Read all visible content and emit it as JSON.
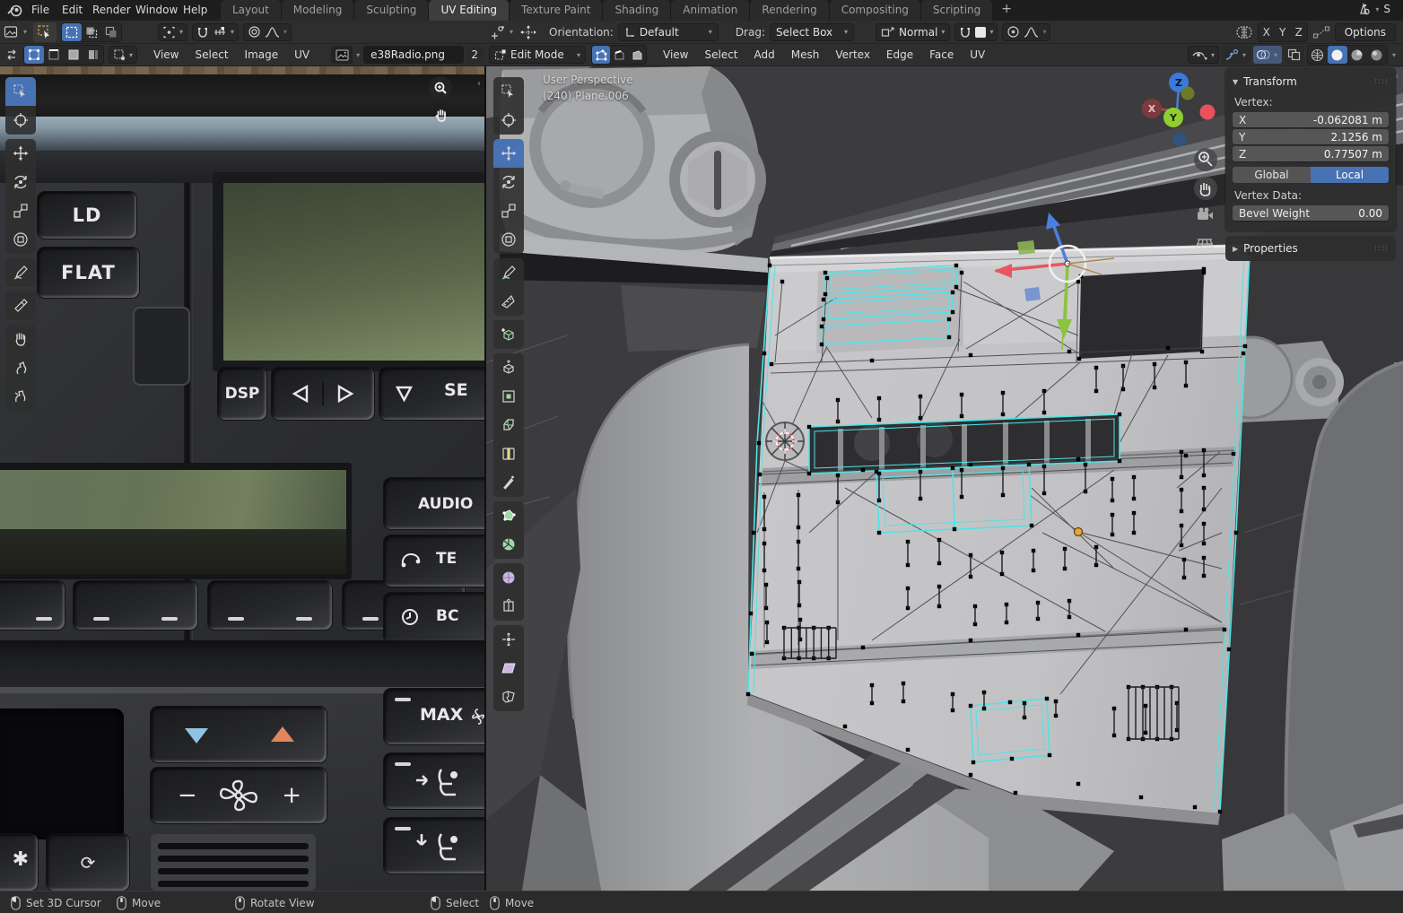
{
  "topbar": {
    "menus": [
      "File",
      "Edit",
      "Render",
      "Window",
      "Help"
    ],
    "tabs": [
      "Layout",
      "Modeling",
      "Sculpting",
      "UV Editing",
      "Texture Paint",
      "Shading",
      "Animation",
      "Rendering",
      "Compositing",
      "Scripting"
    ],
    "active_tab": "UV Editing",
    "new_tab_label": "+",
    "scene_label": "S"
  },
  "uv_editor": {
    "header": {
      "menus": [
        "View",
        "Select",
        "Image",
        "UV"
      ],
      "image_name": "e38Radio.png",
      "image_users": "2"
    },
    "tools": [
      "tweak",
      "cursor",
      "move",
      "rotate",
      "scale",
      "transform",
      "annotate",
      "sample",
      "grab",
      "relax",
      "pinch"
    ],
    "active_tool": "tweak"
  },
  "viewport": {
    "tool_settings": {
      "orientation_label": "Orientation:",
      "orientation_value": "Default",
      "drag_label": "Drag:",
      "drag_value": "Select Box",
      "snap_with_label": "Normal",
      "mirror_axes": [
        "X",
        "Y",
        "Z"
      ],
      "options_label": "Options"
    },
    "header": {
      "mode": "Edit Mode",
      "menus": [
        "View",
        "Select",
        "Add",
        "Mesh",
        "Vertex",
        "Edge",
        "Face",
        "UV"
      ]
    },
    "overlay": {
      "view_label": "User Perspective",
      "object_label": "(240) Plane.006"
    },
    "nav_axes": {
      "x": "X",
      "y": "Y",
      "z": "Z"
    },
    "tools": [
      "tweak",
      "cursor",
      "move",
      "rotate",
      "scale",
      "transform",
      "annotate",
      "measure",
      "add-cube",
      "extrude",
      "inset",
      "bevel",
      "loop-cut",
      "knife",
      "poly-build",
      "spin",
      "smooth",
      "edge-slide",
      "shrink-fatten",
      "shear",
      "rip-region"
    ],
    "active_tool": "move"
  },
  "sidebar": {
    "transform": {
      "title": "Transform",
      "vertex_label": "Vertex:",
      "fields": [
        {
          "label": "X",
          "value": "-0.062081 m"
        },
        {
          "label": "Y",
          "value": "2.1256 m"
        },
        {
          "label": "Z",
          "value": "0.77507 m"
        }
      ],
      "space": [
        {
          "label": "Global",
          "active": false
        },
        {
          "label": "Local",
          "active": true
        }
      ],
      "vertex_data_label": "Vertex Data:",
      "bevel_label": "Bevel Weight",
      "bevel_value": "0.00"
    },
    "properties": {
      "title": "Properties"
    }
  },
  "photo": {
    "labels": {
      "ld": "LD",
      "flat": "FLAT",
      "dsp": "DSP",
      "se": "SE",
      "audio": "AUDIO",
      "tel": "TE",
      "bc": "BC",
      "max": "MAX"
    }
  },
  "statusbar": {
    "hints": [
      {
        "button": "left",
        "label": "Set 3D Cursor"
      },
      {
        "button": "middle",
        "label": "Move"
      },
      {
        "button": "middle-drag",
        "label": "Rotate View"
      },
      {
        "button": "left",
        "label": "Select"
      },
      {
        "button": "middle",
        "label": "Move"
      }
    ]
  },
  "colors": {
    "accent": "#4772b3",
    "selection_edge": "#4fe3e7",
    "vertex": "#000000",
    "origin_dot": "#e8a33d"
  }
}
